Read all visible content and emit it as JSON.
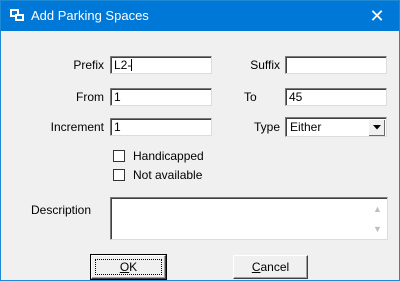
{
  "window": {
    "title": "Add Parking Spaces",
    "close_glyph": "✕"
  },
  "form": {
    "prefix": {
      "label": "Prefix",
      "value": "L2-"
    },
    "suffix": {
      "label": "Suffix",
      "value": ""
    },
    "from": {
      "label": "From",
      "value": "1"
    },
    "to": {
      "label": "To",
      "value": "45"
    },
    "increment": {
      "label": "Increment",
      "value": "1"
    },
    "type": {
      "label": "Type",
      "value": "Either"
    },
    "handicapped": {
      "label": "Handicapped",
      "checked": false
    },
    "not_available": {
      "label": "Not available",
      "checked": false
    },
    "description": {
      "label": "Description",
      "value": ""
    }
  },
  "buttons": {
    "ok": {
      "mnemonic": "O",
      "rest": "K"
    },
    "cancel": {
      "mnemonic": "C",
      "rest": "ancel"
    }
  },
  "colors": {
    "titlebar": "#0078d7",
    "window_bg": "#f0f0f0"
  }
}
